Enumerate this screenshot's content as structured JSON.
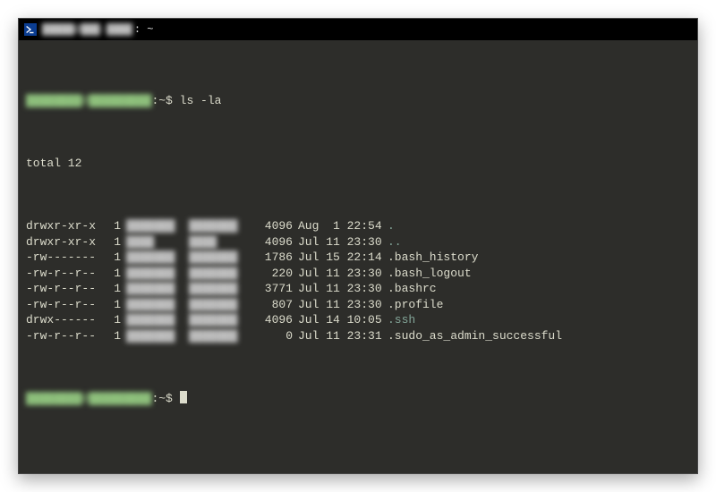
{
  "titlebar": {
    "prefix_blur": "█████@███-████",
    "suffix": ": ~"
  },
  "prompt": {
    "user_blur": "████████@█████████",
    "path": ":~$"
  },
  "commands": {
    "cmd1": "ls -la"
  },
  "output": {
    "total_line": "total 12"
  },
  "listing": [
    {
      "perm": "drwxr-xr-x",
      "links": "1",
      "owner_blur": "███████",
      "group_blur": "███████",
      "size": "4096",
      "date": "Aug  1 22:54",
      "name": ".",
      "class": "dir"
    },
    {
      "perm": "drwxr-xr-x",
      "links": "1",
      "owner_blur": "████",
      "group_blur": "████",
      "size": "4096",
      "date": "Jul 11 23:30",
      "name": "..",
      "class": "dir"
    },
    {
      "perm": "-rw-------",
      "links": "1",
      "owner_blur": "███████",
      "group_blur": "███████",
      "size": "1786",
      "date": "Jul 15 22:14",
      "name": ".bash_history",
      "class": "fname"
    },
    {
      "perm": "-rw-r--r--",
      "links": "1",
      "owner_blur": "███████",
      "group_blur": "███████",
      "size": "220",
      "date": "Jul 11 23:30",
      "name": ".bash_logout",
      "class": "fname"
    },
    {
      "perm": "-rw-r--r--",
      "links": "1",
      "owner_blur": "███████",
      "group_blur": "███████",
      "size": "3771",
      "date": "Jul 11 23:30",
      "name": ".bashrc",
      "class": "fname"
    },
    {
      "perm": "-rw-r--r--",
      "links": "1",
      "owner_blur": "███████",
      "group_blur": "███████",
      "size": "807",
      "date": "Jul 11 23:30",
      "name": ".profile",
      "class": "fname"
    },
    {
      "perm": "drwx------",
      "links": "1",
      "owner_blur": "███████",
      "group_blur": "███████",
      "size": "4096",
      "date": "Jul 14 10:05",
      "name": ".ssh",
      "class": "dir"
    },
    {
      "perm": "-rw-r--r--",
      "links": "1",
      "owner_blur": "███████",
      "group_blur": "███████",
      "size": "0",
      "date": "Jul 11 23:31",
      "name": ".sudo_as_admin_successful",
      "class": "fname"
    }
  ]
}
